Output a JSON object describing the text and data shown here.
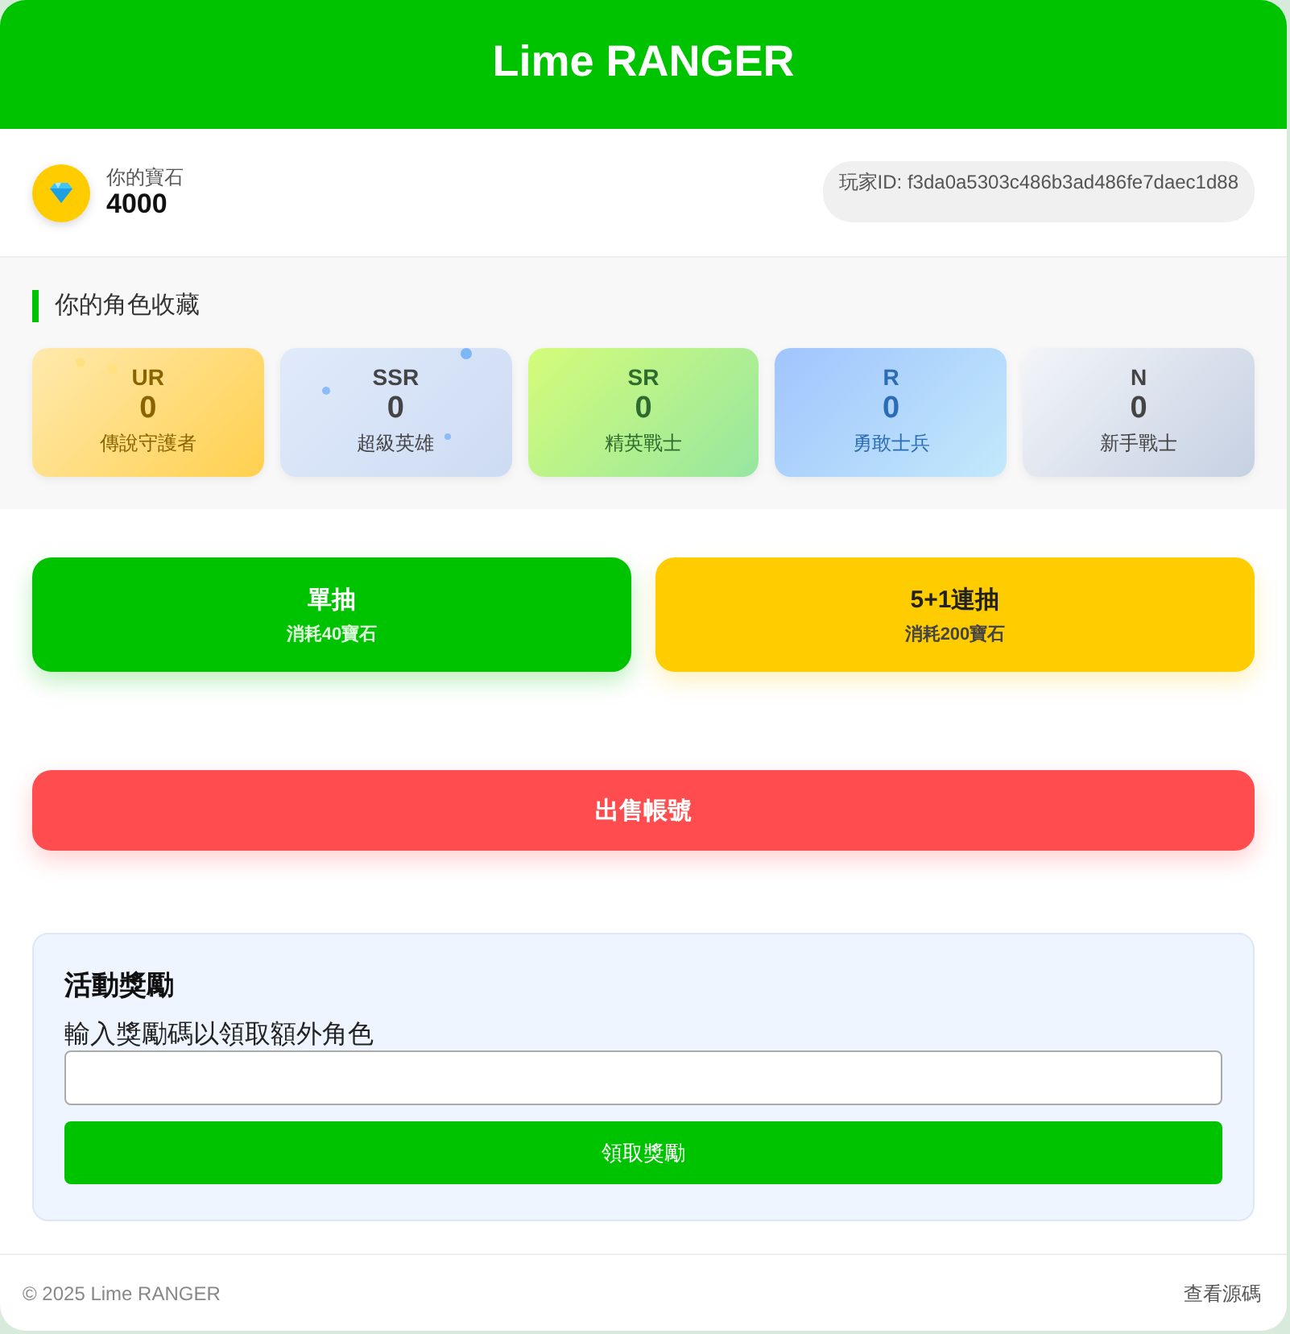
{
  "header": {
    "title": "Lime RANGER"
  },
  "gems": {
    "label": "你的寶石",
    "amount": "4000"
  },
  "player_id": "玩家ID: f3da0a5303c486b3ad486fe7daec1d88",
  "collection": {
    "title": "你的角色收藏",
    "cards": [
      {
        "kind": "ur",
        "rarity": "UR",
        "count": "0",
        "name": "傳說守護者"
      },
      {
        "kind": "ssr",
        "rarity": "SSR",
        "count": "0",
        "name": "超級英雄"
      },
      {
        "kind": "sr",
        "rarity": "SR",
        "count": "0",
        "name": "精英戰士"
      },
      {
        "kind": "r",
        "rarity": "R",
        "count": "0",
        "name": "勇敢士兵"
      },
      {
        "kind": "n",
        "rarity": "N",
        "count": "0",
        "name": "新手戰士"
      }
    ]
  },
  "draw_buttons": [
    {
      "kind": "single",
      "label": "單抽",
      "cost": "消耗40寶石"
    },
    {
      "kind": "multi",
      "label": "5+1連抽",
      "cost": "消耗200寶石"
    }
  ],
  "sell_button": "出售帳號",
  "reward": {
    "title": "活動獎勵",
    "label": "輸入獎勵碼以領取額外角色",
    "button": "領取獎勵"
  },
  "footer": {
    "copyright": "© 2025 Lime RANGER",
    "link": "查看源碼"
  }
}
